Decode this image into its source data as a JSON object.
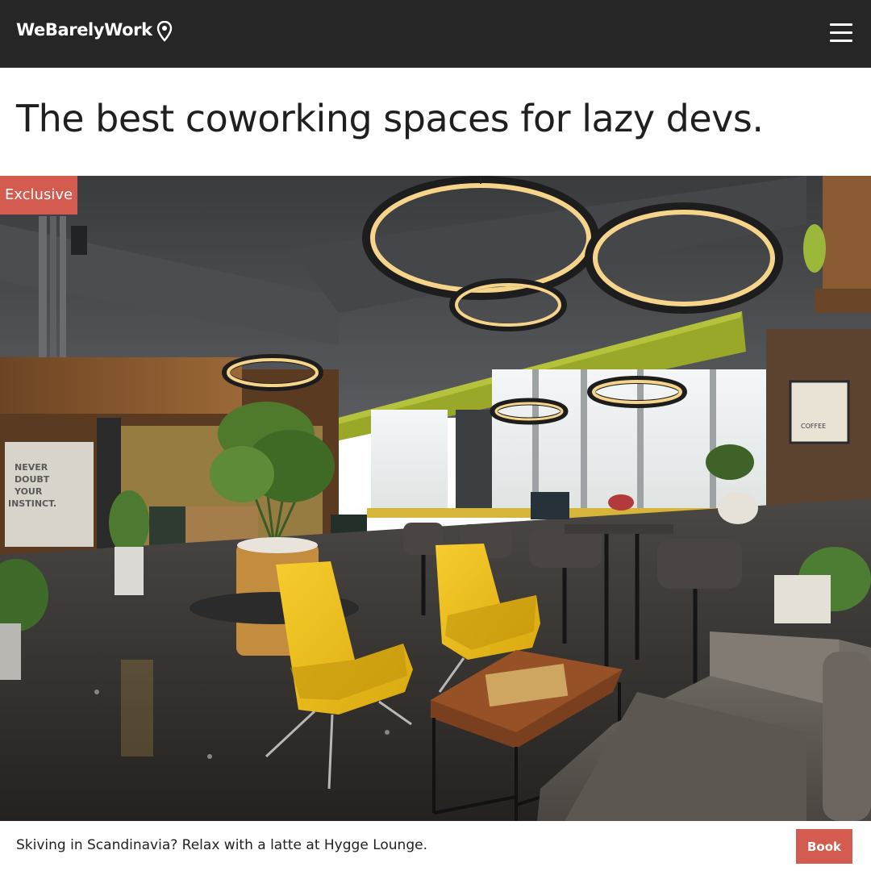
{
  "header": {
    "brand": "WeBarelyWork",
    "location_icon": "map-pin-icon",
    "menu_icon": "hamburger-menu-icon"
  },
  "main": {
    "headline": "The best coworking spaces for lazy devs."
  },
  "feature": {
    "badge": "Exclusive",
    "image_description": "Coworking lounge with ring pendant lights, yellow armchairs, glass coffee table and grey sofa",
    "wall_sign": "NEVER DOUBT YOUR INSTINCT.",
    "caption": "Skiving in Scandinavia? Relax with a latte at Hygge Lounge.",
    "book_label": "Book"
  },
  "colors": {
    "topbar": "#262626",
    "accent": "#d45b4f",
    "chair": "#f0c020",
    "text": "#1f1f1f"
  }
}
